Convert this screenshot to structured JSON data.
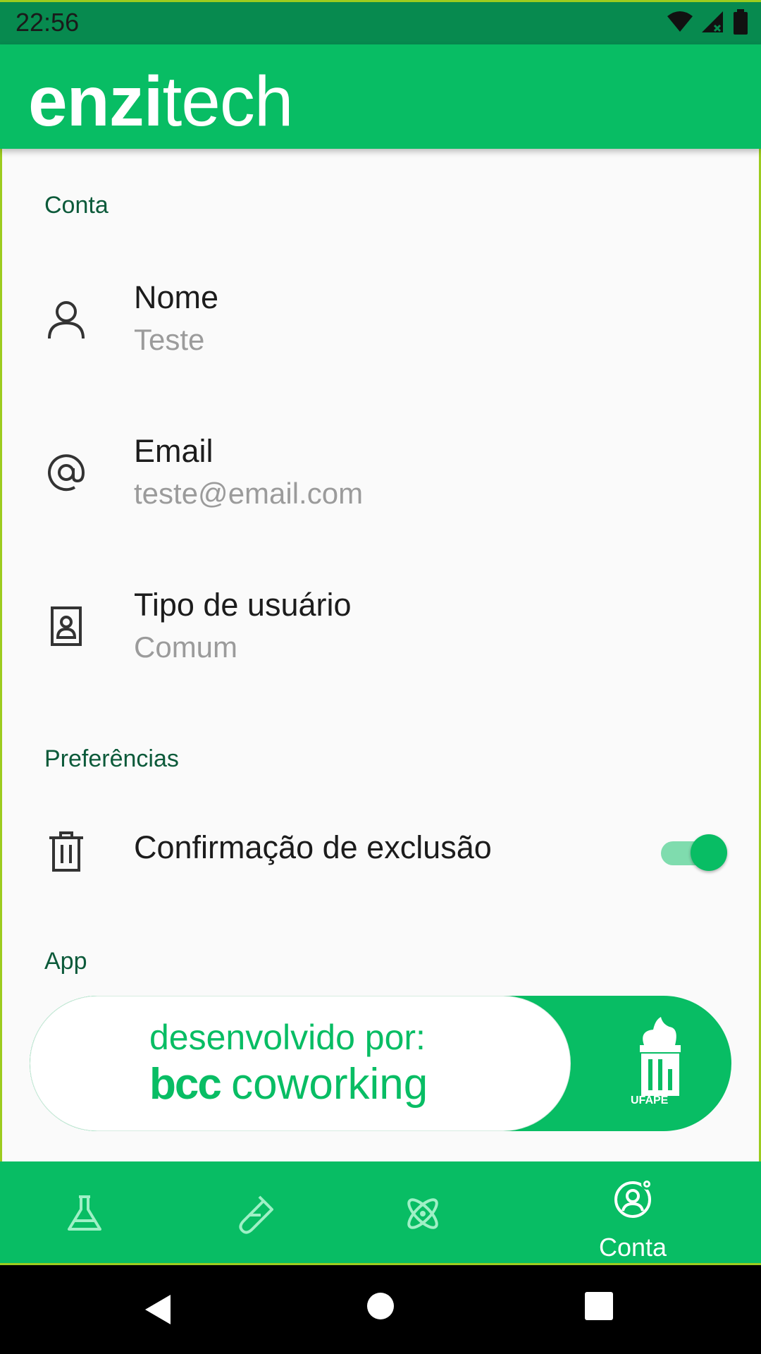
{
  "status_bar": {
    "time": "22:56",
    "icons": [
      "wifi-icon",
      "signal-icon",
      "battery-icon"
    ]
  },
  "app_bar": {
    "logo_bold": "enzi",
    "logo_light": "tech"
  },
  "sections": {
    "account": {
      "title": "Conta",
      "items": [
        {
          "title": "Nome",
          "subtitle": "Teste",
          "icon": "person-icon"
        },
        {
          "title": "Email",
          "subtitle": "teste@email.com",
          "icon": "at-sign-icon"
        },
        {
          "title": "Tipo de usuário",
          "subtitle": "Comum",
          "icon": "badge-icon"
        }
      ]
    },
    "preferences": {
      "title": "Preferências",
      "items": [
        {
          "title": "Confirmação de exclusão",
          "icon": "trash-icon",
          "toggle_on": true
        }
      ]
    },
    "app": {
      "title": "App",
      "banner": {
        "line1": "desenvolvido por:",
        "line2_bold": "bcc",
        "line2_light": "coworking",
        "institution": "UFAPE"
      }
    }
  },
  "bottom_nav": {
    "items": [
      {
        "icon": "flask-icon",
        "label": ""
      },
      {
        "icon": "test-tube-icon",
        "label": ""
      },
      {
        "icon": "atom-icon",
        "label": ""
      },
      {
        "icon": "account-settings-icon",
        "label": "Conta",
        "selected": true
      }
    ]
  },
  "colors": {
    "primary": "#08bd64",
    "status_bar": "#078a4f",
    "section_title": "#0c5a3a",
    "background": "#fafafa"
  }
}
